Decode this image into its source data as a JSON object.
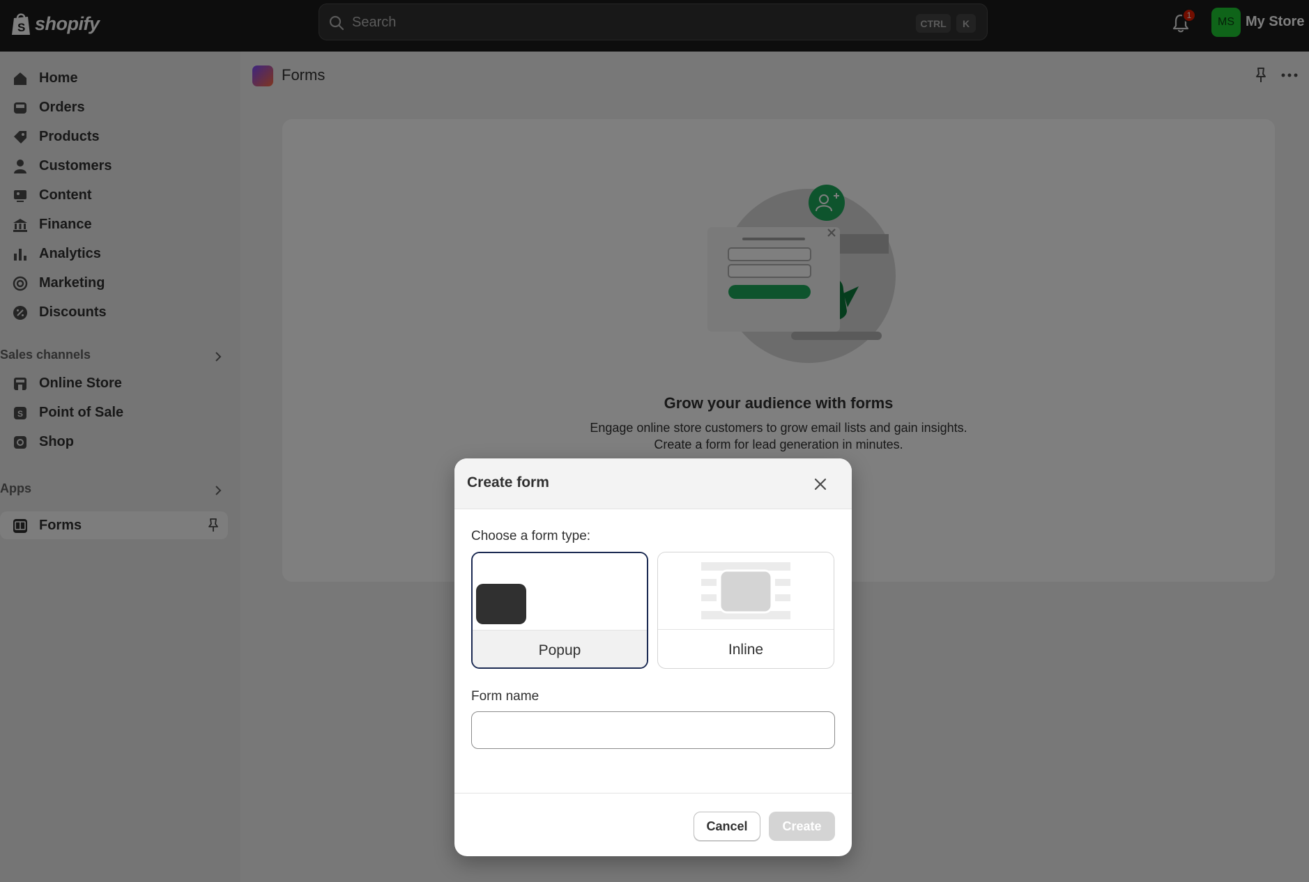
{
  "topbar": {
    "brand": "shopify",
    "search_placeholder": "Search",
    "kbd_ctrl": "CTRL",
    "kbd_k": "K",
    "notification_count": "1",
    "avatar_initials": "MS",
    "store_name": "My Store"
  },
  "sidebar": {
    "items": [
      {
        "label": "Home",
        "icon": "home-icon"
      },
      {
        "label": "Orders",
        "icon": "inbox-icon"
      },
      {
        "label": "Products",
        "icon": "tag-icon"
      },
      {
        "label": "Customers",
        "icon": "person-icon"
      },
      {
        "label": "Content",
        "icon": "image-icon"
      },
      {
        "label": "Finance",
        "icon": "bank-icon"
      },
      {
        "label": "Analytics",
        "icon": "bar-chart-icon"
      },
      {
        "label": "Marketing",
        "icon": "target-icon"
      },
      {
        "label": "Discounts",
        "icon": "discount-icon"
      }
    ],
    "sales_channels_title": "Sales channels",
    "sales_channels": [
      {
        "label": "Online Store",
        "icon": "store-icon"
      },
      {
        "label": "Point of Sale",
        "icon": "pos-icon"
      },
      {
        "label": "Shop",
        "icon": "shop-icon"
      }
    ],
    "apps_title": "Apps",
    "apps": [
      {
        "label": "Forms",
        "icon": "forms-app-icon"
      }
    ]
  },
  "main": {
    "title": "Forms",
    "card_title": "Grow your audience with forms",
    "card_desc_1": "Engage online store customers to grow email lists and gain insights.",
    "card_desc_2": "Create a form for lead generation in minutes."
  },
  "modal": {
    "title": "Create form",
    "choose_label": "Choose a form type:",
    "types": [
      {
        "label": "Popup",
        "selected": true
      },
      {
        "label": "Inline",
        "selected": false
      }
    ],
    "name_label": "Form name",
    "name_value": "",
    "cancel_label": "Cancel",
    "create_label": "Create"
  },
  "colors": {
    "topbar": "#1a1a1a",
    "accent_green": "#1ec933",
    "selected_border": "#1b2a52",
    "badge_red": "#e51c00"
  }
}
